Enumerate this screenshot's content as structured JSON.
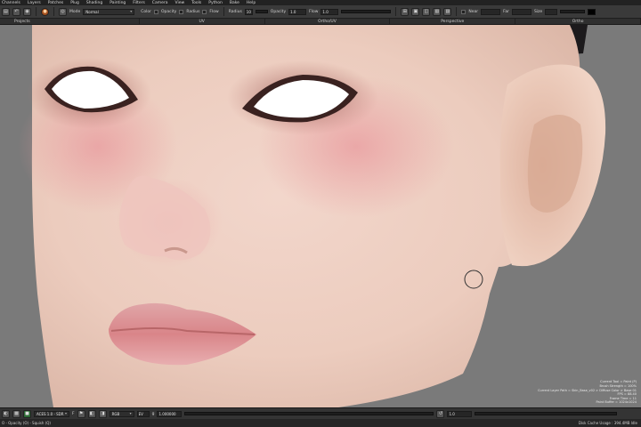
{
  "menu": [
    "Channels",
    "Layers",
    "Patches",
    "Plug",
    "Shading",
    "Painting",
    "Filters",
    "Camera",
    "View",
    "Tools",
    "Python",
    "Bake",
    "Help"
  ],
  "toolbar": {
    "mode_label": "Mode",
    "mode_value": "Normal",
    "color_label": "Color",
    "opacity_label": "Opacity",
    "radius_label": "Radius",
    "flow_label": "Flow",
    "radius_field_label": "Radius",
    "radius_value": "10",
    "opacity_field_label": "Opacity",
    "opacity_value": "1.0",
    "flow_field_label": "Flow",
    "flow_value": "1.0",
    "near_label": "Near",
    "far_label": "Far",
    "size_label": "Size",
    "color_swatch": "#000000",
    "orange_accent": "#a5501e"
  },
  "tabs": [
    "Projects",
    "UV",
    "Ortho/UV",
    "Perspective",
    "Ortho"
  ],
  "hud_lines": [
    "Current Tool = Paint (P)",
    "Brush Strength = 100%",
    "Current Layer Path = Skin_Base_v02 > Diffuse Color > Base 01",
    "FPS = 88.40",
    "Frame Time = 11",
    "Paint Buffer = 1024x1024"
  ],
  "bottom": {
    "colorspace": "ACES 1.0 - SDR",
    "channels": "RGB",
    "f_label": "F",
    "exposure": "EV",
    "gamma": "1.000000",
    "g_label": "g",
    "value": "1.0"
  },
  "status": {
    "left": "O - Opacity (O) - Squish (Q)",
    "right": "Disk Cache Usage : 394.4MB  Idle"
  }
}
